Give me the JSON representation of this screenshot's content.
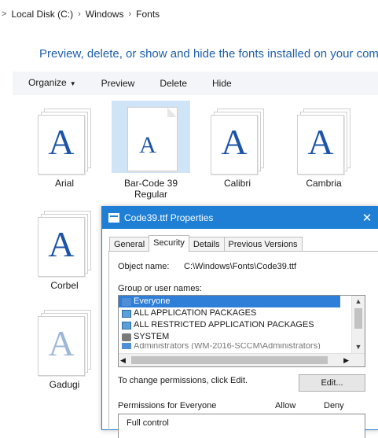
{
  "breadcrumb": {
    "items": [
      "Local Disk (C:)",
      "Windows",
      "Fonts"
    ]
  },
  "heading": "Preview, delete, or show and hide the fonts installed on your com",
  "toolbar": {
    "organize": "Organize",
    "preview": "Preview",
    "delete": "Delete",
    "hide": "Hide"
  },
  "fonts": [
    {
      "name": "Arial"
    },
    {
      "name": "Bar-Code 39 Regular"
    },
    {
      "name": "Calibri"
    },
    {
      "name": "Cambria"
    },
    {
      "name": "Corbel"
    },
    {
      "name": "Gadugi"
    }
  ],
  "glyph": "A",
  "dialog": {
    "title": "Code39.ttf Properties",
    "close": "✕",
    "tabs": [
      "General",
      "Security",
      "Details",
      "Previous Versions"
    ],
    "object_label": "Object name:",
    "object_value": "C:\\Windows\\Fonts\\Code39.ttf",
    "group_label": "Group or user names:",
    "users": [
      "Everyone",
      "ALL APPLICATION PACKAGES",
      "ALL RESTRICTED APPLICATION PACKAGES",
      "SYSTEM",
      "Administrators (WM-2016-SCCM\\Administrators)"
    ],
    "change_text": "To change permissions, click Edit.",
    "edit_button": "Edit...",
    "perm_header": "Permissions for Everyone",
    "allow": "Allow",
    "deny": "Deny",
    "permissions": [
      "Full control"
    ]
  },
  "colors": {
    "accent": "#1e7fd4",
    "heading": "#1f5fa8",
    "glyph": "#1c54a8",
    "selection": "#2f7fd8"
  }
}
